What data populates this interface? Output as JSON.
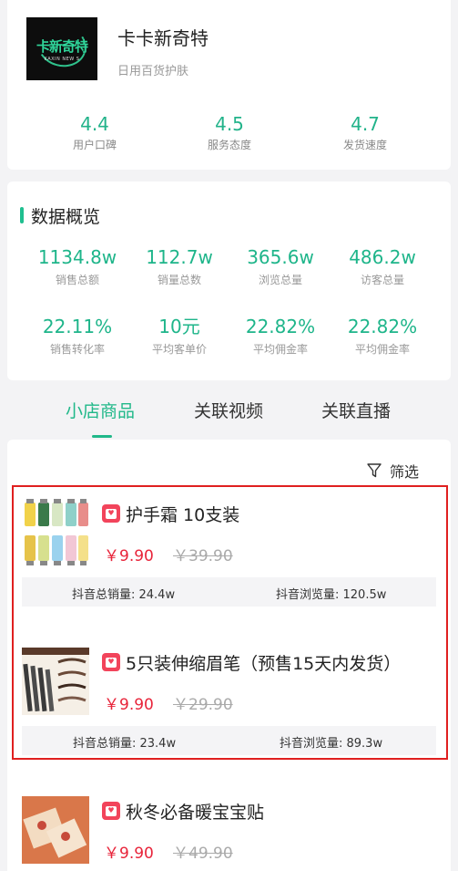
{
  "shop": {
    "logo_cn": "卡新奇特",
    "logo_en": "KAXIN NEW S",
    "name": "卡卡新奇特",
    "category": "日用百货护肤",
    "ratings": [
      {
        "value": "4.4",
        "label": "用户口碑"
      },
      {
        "value": "4.5",
        "label": "服务态度"
      },
      {
        "value": "4.7",
        "label": "发货速度"
      }
    ]
  },
  "overview": {
    "title": "数据概览",
    "metrics": [
      {
        "value": "1134.8w",
        "label": "销售总额"
      },
      {
        "value": "112.7w",
        "label": "销量总数"
      },
      {
        "value": "365.6w",
        "label": "浏览总量"
      },
      {
        "value": "486.2w",
        "label": "访客总量"
      },
      {
        "value": "22.11%",
        "label": "销售转化率"
      },
      {
        "value": "10元",
        "label": "平均客单价"
      },
      {
        "value": "22.82%",
        "label": "平均佣金率"
      },
      {
        "value": "22.82%",
        "label": "平均佣金率"
      }
    ]
  },
  "tabs": [
    "小店商品",
    "关联视频",
    "关联直播"
  ],
  "active_tab": 0,
  "filter_label": "筛选",
  "products": [
    {
      "title": "护手霜 10支装",
      "price": "￥9.90",
      "original_price": "￥39.90",
      "sales": "抖音总销量: 24.4w",
      "views": "抖音浏览量: 120.5w"
    },
    {
      "title": "5只装伸缩眉笔（预售15天内发货）",
      "price": "￥9.90",
      "original_price": "￥29.90",
      "sales": "抖音总销量: 23.4w",
      "views": "抖音浏览量: 89.3w"
    },
    {
      "title": "秋冬必备暖宝宝贴",
      "price": "￥9.90",
      "original_price": "￥49.90"
    }
  ],
  "colors": {
    "accent": "#20b889",
    "price": "#e8243a",
    "badge": "#f2445b",
    "highlight_border": "#e02020"
  }
}
